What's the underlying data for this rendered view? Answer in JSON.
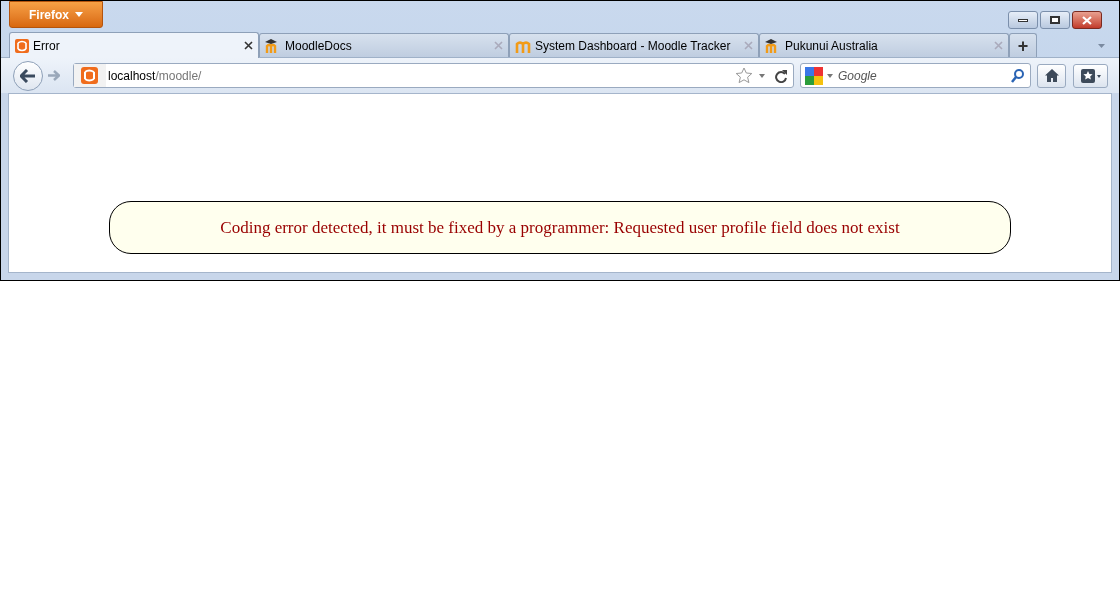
{
  "app_button": {
    "label": "Firefox"
  },
  "tabs": [
    {
      "label": "Error",
      "selected": true,
      "kind": "xampp"
    },
    {
      "label": "MoodleDocs",
      "selected": false,
      "kind": "hat"
    },
    {
      "label": "System Dashboard - Moodle Tracker",
      "selected": false,
      "kind": "m"
    },
    {
      "label": "Pukunui Australia",
      "selected": false,
      "kind": "hat"
    }
  ],
  "new_tab": "+",
  "address": {
    "host": "localhost",
    "path": "/moodle/"
  },
  "search": {
    "placeholder": "Google"
  },
  "error_message": "Coding error detected, it must be fixed by a programmer: Requested user profile field does not exist"
}
